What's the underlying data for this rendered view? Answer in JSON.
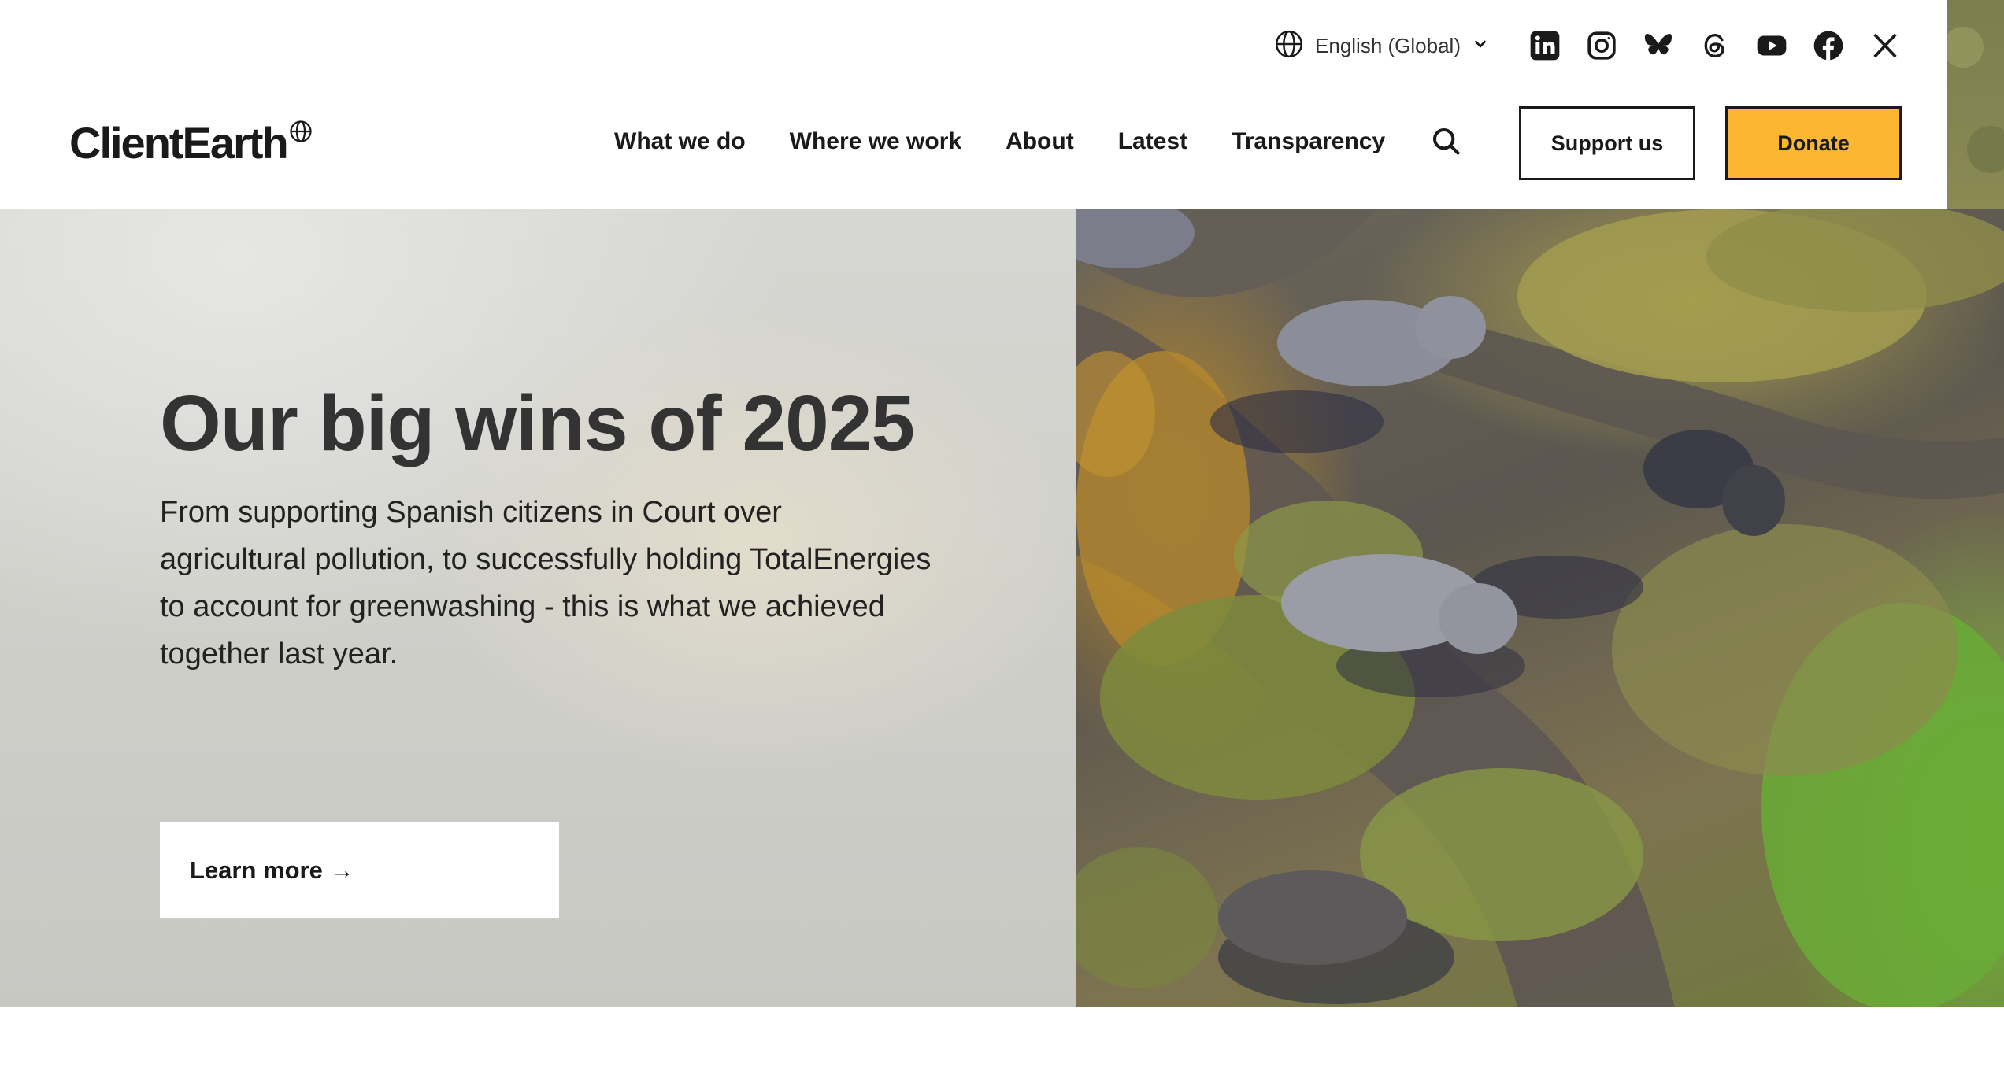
{
  "header": {
    "language": {
      "label": "English (Global)",
      "icon": "globe-icon",
      "chevron": "chevron-down-icon"
    },
    "socials": [
      {
        "name": "linkedin-icon"
      },
      {
        "name": "instagram-icon"
      },
      {
        "name": "bluesky-icon"
      },
      {
        "name": "threads-icon"
      },
      {
        "name": "youtube-icon"
      },
      {
        "name": "facebook-icon"
      },
      {
        "name": "x-icon"
      }
    ],
    "logo": {
      "text": "ClientEarth"
    },
    "nav": [
      "What we do",
      "Where we work",
      "About",
      "Latest",
      "Transparency"
    ],
    "support_label": "Support us",
    "donate_label": "Donate"
  },
  "hero": {
    "title": "Our big wins of 2025",
    "description": "From supporting Spanish citizens in Court over agricultural pollution, to successfully holding TotalEnergies to account for greenwashing - this is what we achieved together last year.",
    "cta_label": "Learn more →",
    "image": "elephants-aerial-photo"
  },
  "colors": {
    "donate": "#fbb731",
    "text": "#1a1a1a",
    "title": "#333333"
  }
}
